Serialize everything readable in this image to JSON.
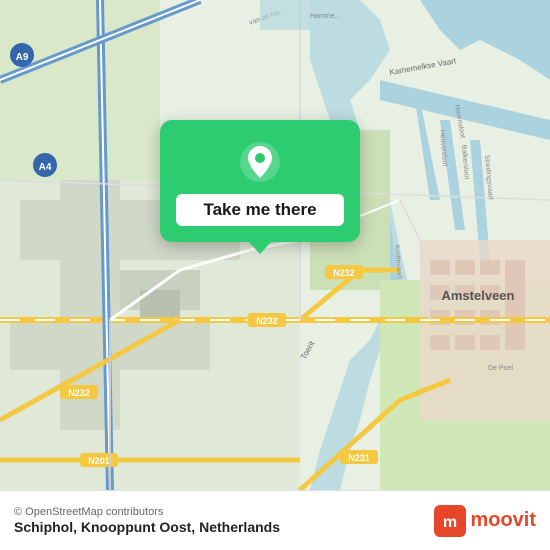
{
  "map": {
    "background_color": "#e8f0e4",
    "center_lat": 52.31,
    "center_lng": 4.76
  },
  "tooltip": {
    "label": "Take me there",
    "pin_color": "white",
    "bg_color": "#2ecc71"
  },
  "footer": {
    "location_name": "Schiphol, Knooppunt Oost, Netherlands",
    "attribution": "© OpenStreetMap contributors",
    "moovit_label": "moovit"
  },
  "road_labels": [
    "A9",
    "A4",
    "N232",
    "N232",
    "N232",
    "N201",
    "N231"
  ],
  "area_labels": [
    "Amstelveen"
  ]
}
